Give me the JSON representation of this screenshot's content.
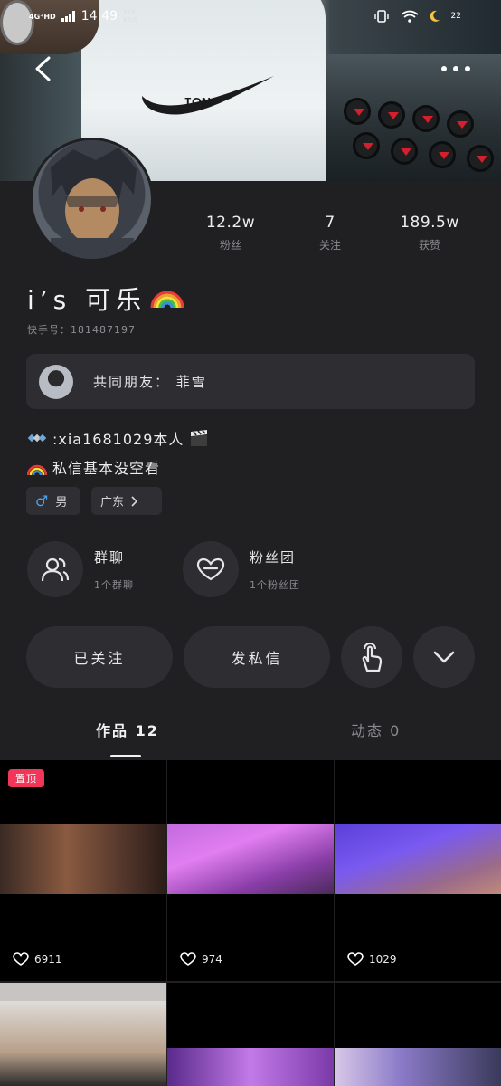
{
  "status_bar": {
    "network": "4G⁺HD",
    "signal": "4G",
    "time": "14:49",
    "speed_value": "115",
    "speed_unit": "KB/S",
    "battery": "22"
  },
  "profile": {
    "nickname": "i’s 可乐",
    "account_id": "快手号：181487197",
    "stats": [
      {
        "value": "12.2w",
        "label": "粉丝"
      },
      {
        "value": "7",
        "label": "关注"
      },
      {
        "value": "189.5w",
        "label": "获赞"
      }
    ],
    "mutual_friends": "共同朋友：  菲雪",
    "bio_line1": ":xia1681029本人",
    "bio_line2": "私信基本没空看",
    "gender_tag": "男",
    "region_tag": "广东",
    "gender_symbol": "♂"
  },
  "features": {
    "group_chat": {
      "title": "群聊",
      "subtitle": "1个群聊"
    },
    "fan_club": {
      "title": "粉丝团",
      "subtitle": "1个粉丝团"
    }
  },
  "actions": {
    "followed_label": "已关注",
    "message_label": "发私信"
  },
  "tabs": {
    "works": "作品 12",
    "moments": "动态 0"
  },
  "grid": {
    "top_badge": "置顶",
    "tiles": [
      {
        "likes": "6911"
      },
      {
        "likes": "974"
      },
      {
        "likes": "1029"
      }
    ]
  },
  "colors": {
    "background": "#202023",
    "card": "#2e2e32",
    "badge": "#f2365a",
    "rainbow": [
      "#e63b3b",
      "#f39c33",
      "#f5e13a",
      "#45c146",
      "#3b8ee6",
      "#8e4ad6"
    ]
  },
  "icons": {
    "back": "chevron-left-icon",
    "more": "more-dots-icon",
    "group": "group-icon",
    "fans": "heart-icon",
    "poke": "tap-hand-icon",
    "expand": "chevron-down-icon",
    "like": "heart-outline-icon"
  }
}
